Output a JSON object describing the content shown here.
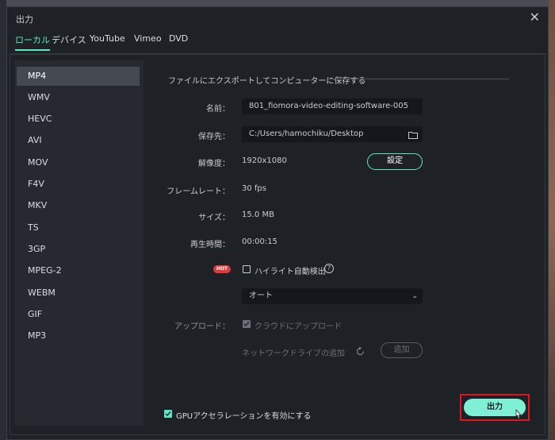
{
  "window": {
    "title": "出力",
    "close_glyph": "✕"
  },
  "tabs": [
    {
      "label": "ローカル",
      "active": true
    },
    {
      "label": "デバイス"
    },
    {
      "label": "YouTube"
    },
    {
      "label": "Vimeo"
    },
    {
      "label": "DVD"
    }
  ],
  "formats": [
    "MP4",
    "WMV",
    "HEVC",
    "AVI",
    "MOV",
    "F4V",
    "MKV",
    "TS",
    "3GP",
    "MPEG-2",
    "WEBM",
    "GIF",
    "MP3"
  ],
  "selected_format": "MP4",
  "section_title": "ファイルにエクスポートしてコンピューターに保存する",
  "fields": {
    "name_label": "名前：",
    "name_value": "801_fiomora-video-editing-software-005",
    "save_label": "保存先：",
    "save_value": "C:/Users/hamochiku/Desktop",
    "resolution_label": "解像度：",
    "resolution_value": "1920x1080",
    "settings_button": "設定",
    "framerate_label": "フレームレート：",
    "framerate_value": "30 fps",
    "size_label": "サイズ：",
    "size_value": "15.0 MB",
    "duration_label": "再生時間：",
    "duration_value": "00:00:15",
    "hot_badge": "HOT",
    "highlight_label": "ハイライト自動検出",
    "highlight_help": "?",
    "auto_select": "オート",
    "upload_label": "アップロード：",
    "cloud_label": "クラウドにアップロード",
    "network_label": "ネットワークドライブの追加",
    "add_button": "追加"
  },
  "gpu_label": "GPUアクセラレーションを有効にする",
  "export_button": "出力",
  "colors": {
    "accent": "#5ce6c8",
    "highlight_box": "#e0161d",
    "dialog_bg": "#1e2227"
  }
}
